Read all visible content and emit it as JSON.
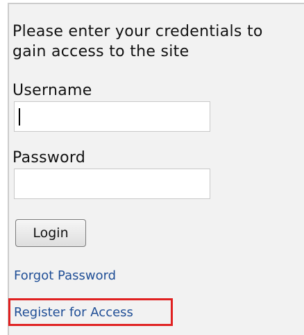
{
  "login": {
    "intro_text": "Please enter your credentials to gain access to the site",
    "username_label": "Username",
    "username_value": "",
    "password_label": "Password",
    "password_value": "",
    "login_button_label": "Login",
    "forgot_password_link": "Forgot Password",
    "register_link": "Register for Access"
  },
  "colors": {
    "panel_background": "#f2f2f2",
    "link": "#1f4e96",
    "highlight": "#e02020"
  }
}
